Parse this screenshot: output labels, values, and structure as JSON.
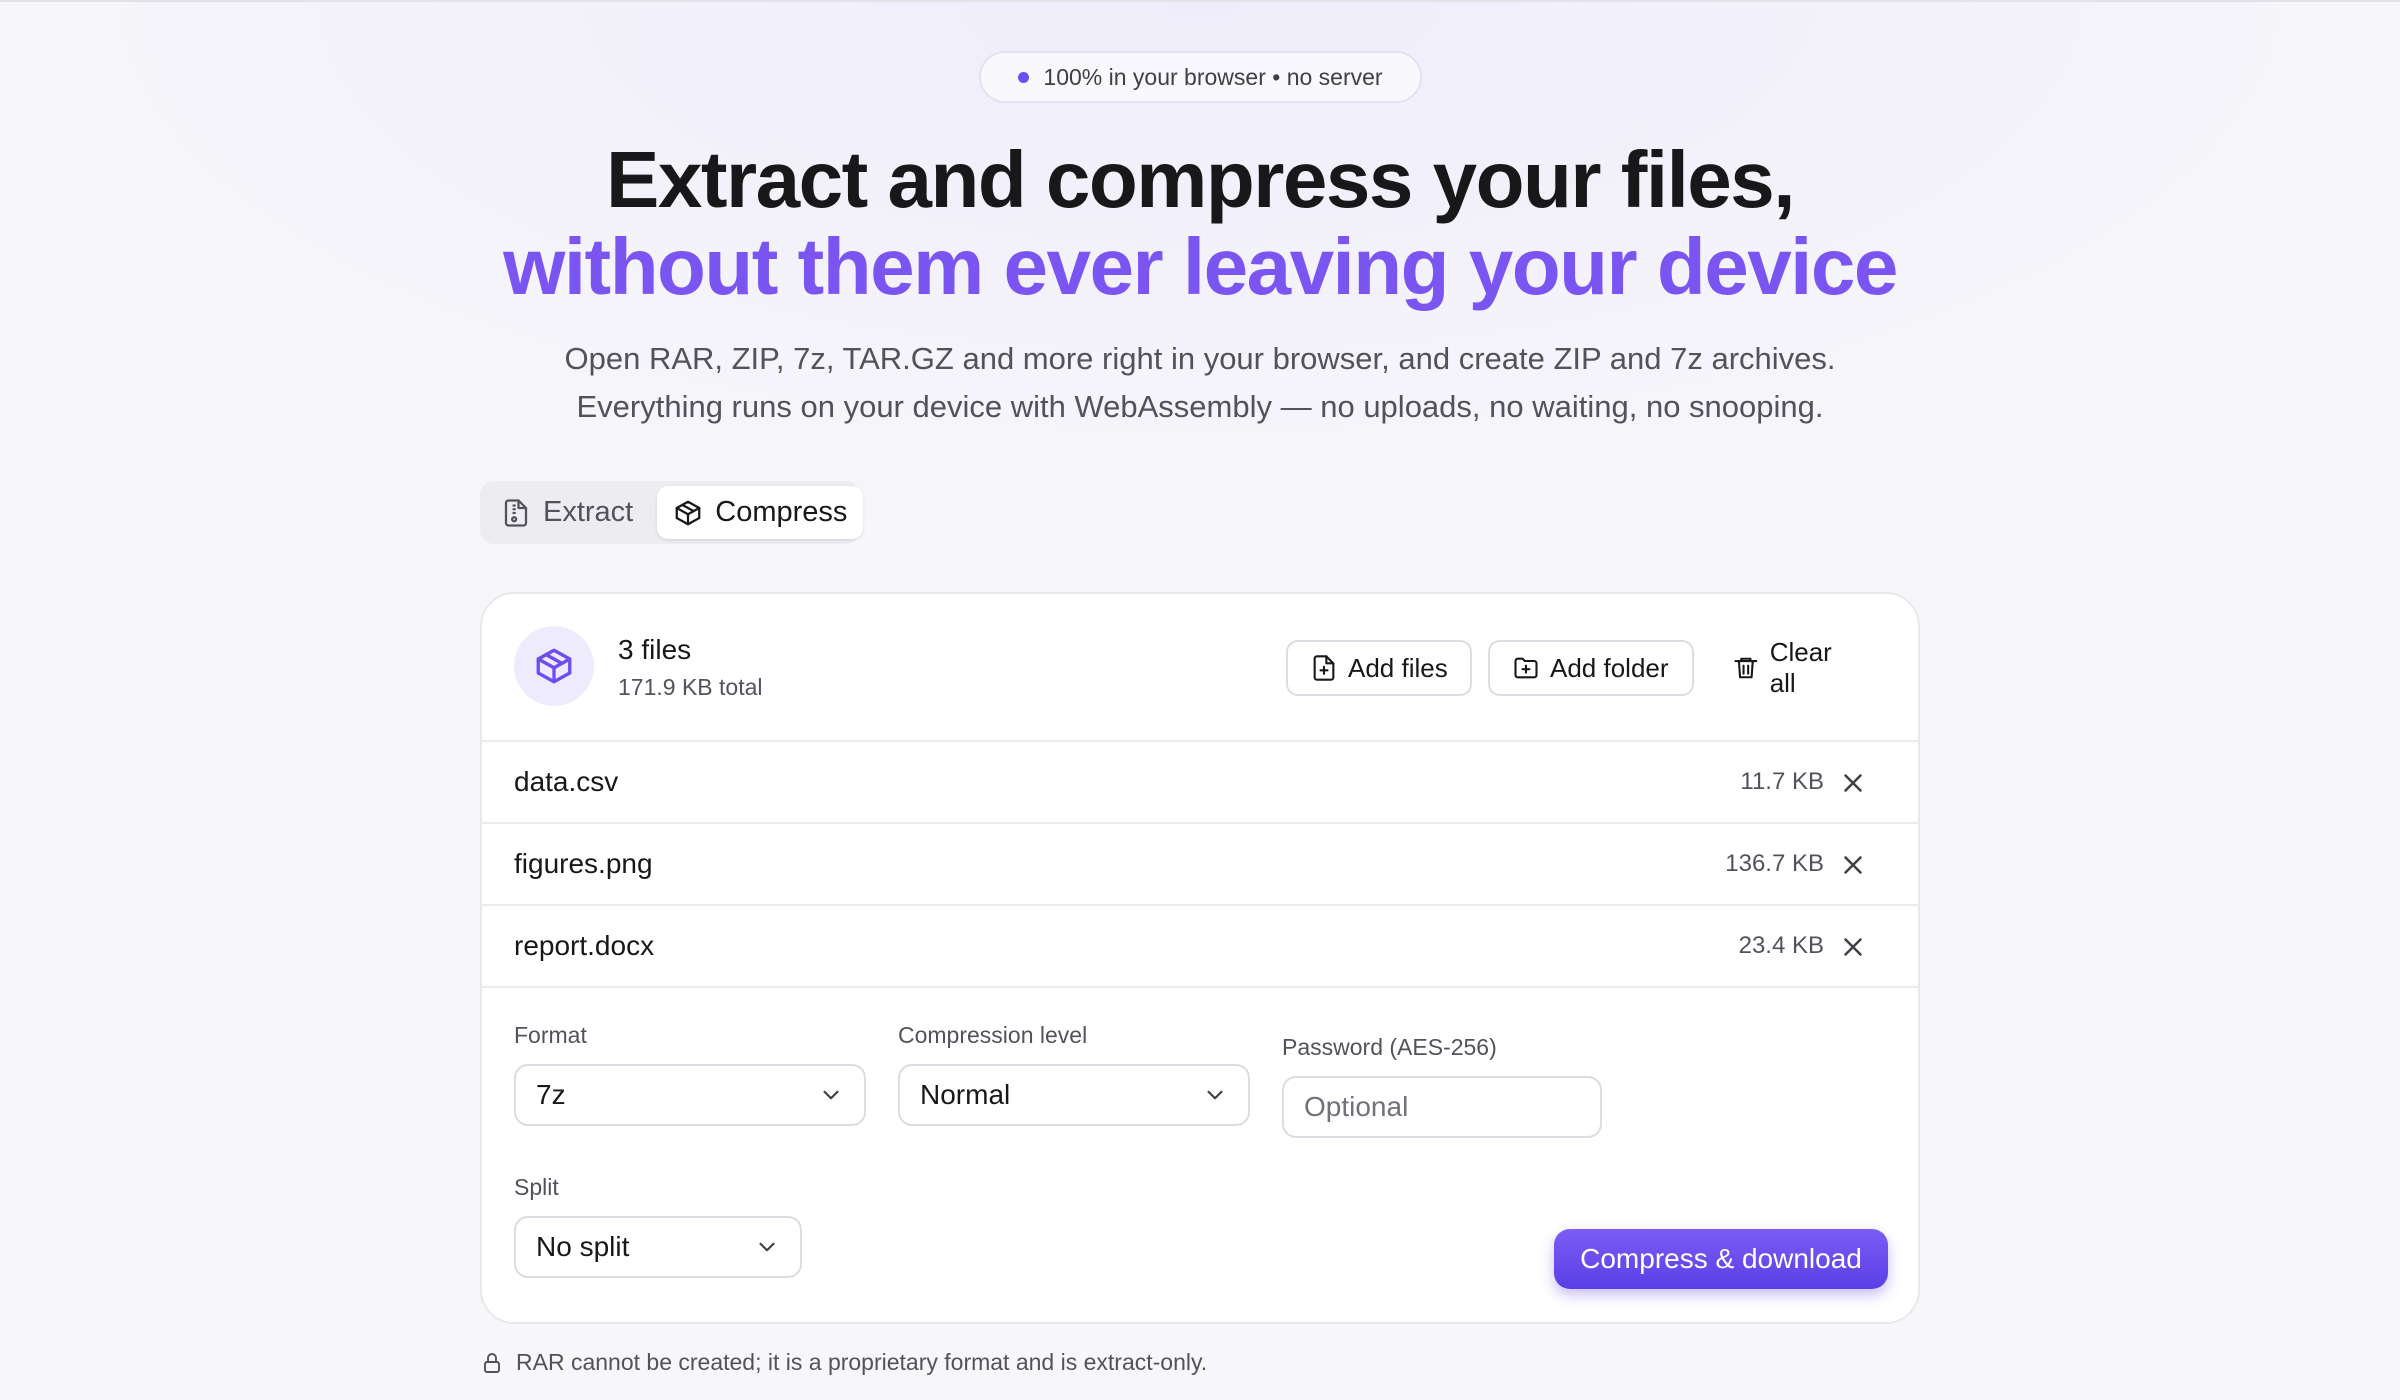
{
  "badge": {
    "text": "100% in your browser • no server"
  },
  "hero": {
    "line1": "Extract and compress your files,",
    "line2": "without them ever leaving your device",
    "sub1": "Open RAR, ZIP, 7z, TAR.GZ and more right in your browser, and create ZIP and 7z archives.",
    "sub2": "Everything runs on your device with WebAssembly — no uploads, no waiting, no snooping."
  },
  "tabs": [
    {
      "label": "Extract",
      "icon": "file-archive-icon",
      "active": false
    },
    {
      "label": "Compress",
      "icon": "package-icon",
      "active": true
    }
  ],
  "summary": {
    "count": "3 files",
    "total": "171.9 KB total"
  },
  "toolbar": {
    "add_files": "Add files",
    "add_folder": "Add folder",
    "clear_all": "Clear all"
  },
  "files": [
    {
      "name": "data.csv",
      "size": "11.7 KB"
    },
    {
      "name": "figures.png",
      "size": "136.7 KB"
    },
    {
      "name": "report.docx",
      "size": "23.4 KB"
    }
  ],
  "options": {
    "format": {
      "label": "Format",
      "value": "7z"
    },
    "level": {
      "label": "Compression level",
      "value": "Normal"
    },
    "password": {
      "label": "Password (AES-256)",
      "placeholder": "Optional"
    },
    "split": {
      "label": "Split",
      "value": "No split"
    }
  },
  "action": {
    "label": "Compress & download"
  },
  "note": {
    "text": "RAR cannot be created; it is a proprietary format and is extract-only."
  },
  "colors": {
    "accent": "#7a55f2",
    "accent_dark": "#5a3fe6",
    "text": "#18181b",
    "muted": "#52525b"
  }
}
